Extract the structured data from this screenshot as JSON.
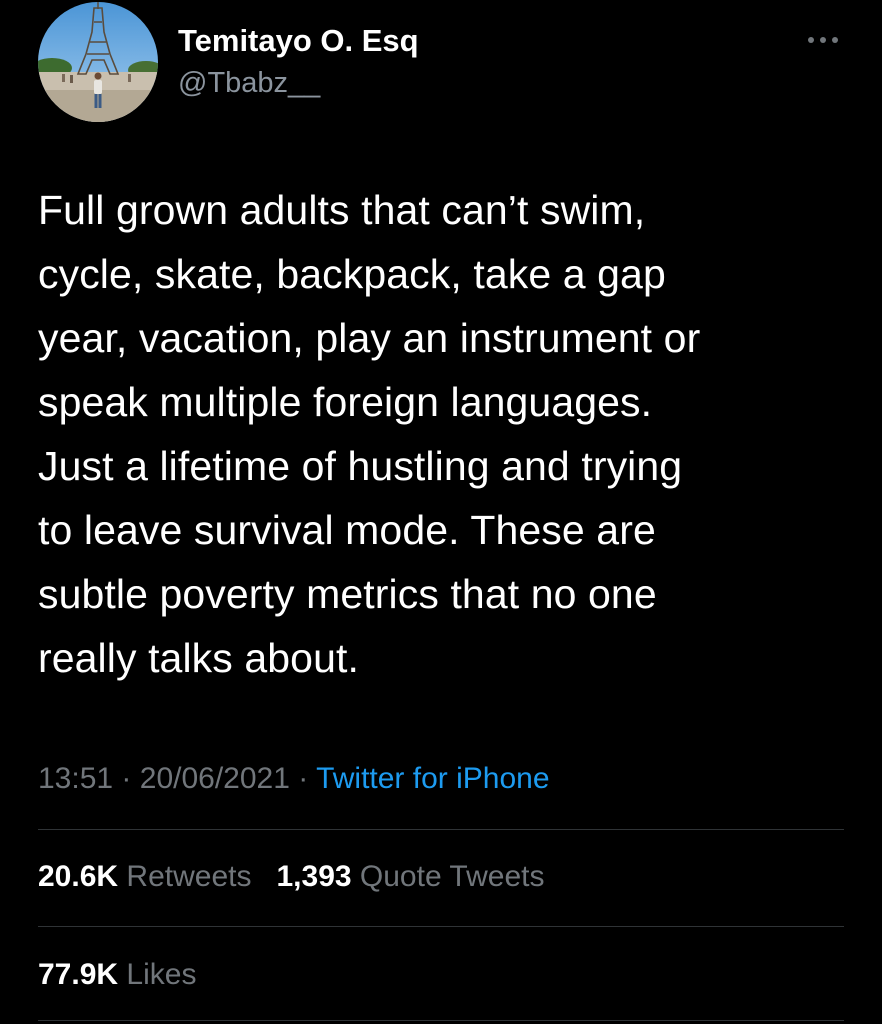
{
  "user": {
    "display_name": "Temitayo O. Esq",
    "handle": "@Tbabz__",
    "avatar_icon": "profile-photo-eiffel-tower"
  },
  "tweet": {
    "text": "Full grown adults that can’t swim,\ncycle, skate, backpack, take a gap\nyear, vacation, play an instrument or\nspeak multiple foreign languages.\nJust a lifetime of hustling and trying\nto leave survival mode. These are\nsubtle poverty metrics that no one\nreally talks about.",
    "time": "13:51",
    "separator": "·",
    "date": "20/06/2021",
    "source": "Twitter for iPhone"
  },
  "stats": {
    "retweets_count": "20.6K",
    "retweets_label": "Retweets",
    "quotes_count": "1,393",
    "quotes_label": "Quote Tweets",
    "likes_count": "77.9K",
    "likes_label": "Likes"
  },
  "icons": {
    "more": "more-horizontal-icon"
  },
  "colors": {
    "background": "#000000",
    "text": "#ffffff",
    "secondary": "#71767b",
    "link": "#1d9bf0",
    "divider": "#2f3336"
  }
}
